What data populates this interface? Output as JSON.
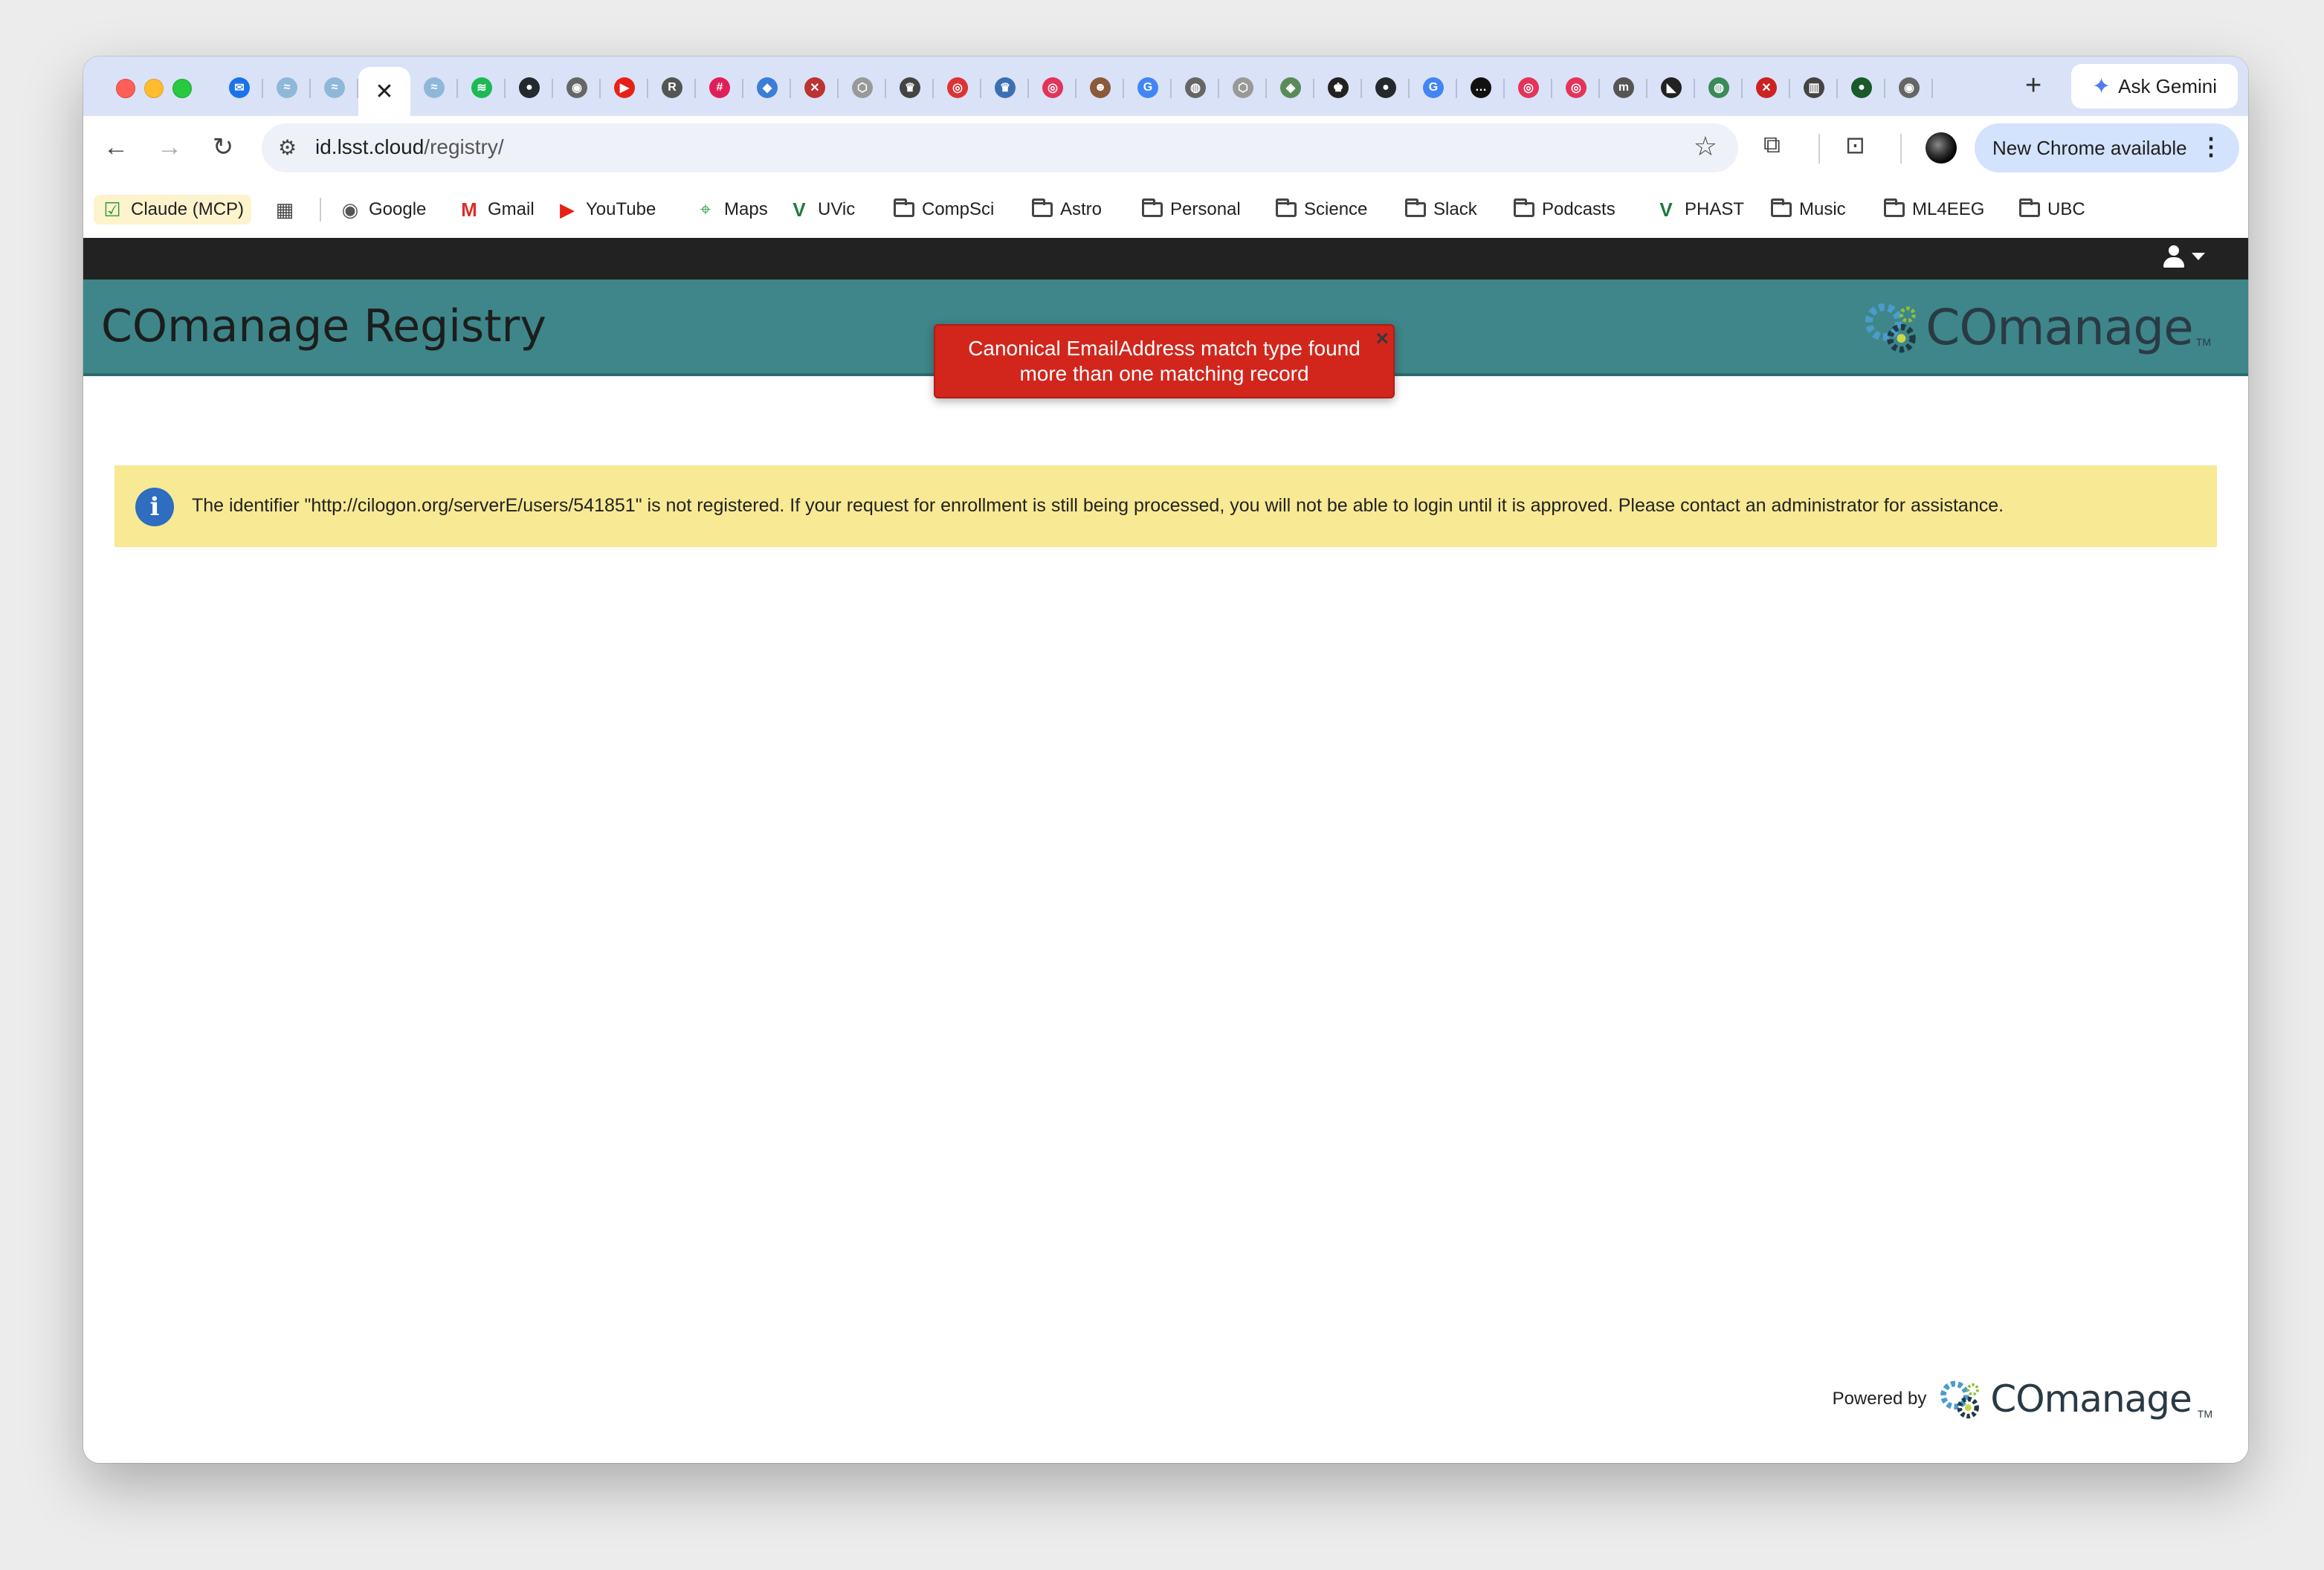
{
  "browser": {
    "url_host": "id.lsst.cloud",
    "url_path": "/registry/",
    "ask_gemini_label": "Ask Gemini",
    "update_label": "New Chrome available",
    "new_tab_symbol": "+",
    "tab_favicons": [
      {
        "icon": "outlook-icon",
        "color": "#1a73e8",
        "glyph": "✉"
      },
      {
        "icon": "cloud-icon",
        "color": "#8fb8d8",
        "glyph": "≈"
      },
      {
        "icon": "cloud-icon",
        "color": "#8fb8d8",
        "glyph": "≈"
      },
      {
        "icon": "close-icon",
        "active": true
      },
      {
        "icon": "cloud-icon",
        "color": "#8fb8d8",
        "glyph": "≈"
      },
      {
        "icon": "spotify-icon",
        "color": "#1db954",
        "glyph": "≋"
      },
      {
        "icon": "github-icon",
        "color": "#24292e",
        "glyph": "●"
      },
      {
        "icon": "chrome-icon",
        "color": "#666",
        "glyph": "◉"
      },
      {
        "icon": "youtube-icon",
        "color": "#e62117",
        "glyph": "▶"
      },
      {
        "icon": "r-icon",
        "color": "#555",
        "glyph": "R"
      },
      {
        "icon": "slack-icon",
        "color": "#e01e5a",
        "glyph": "#"
      },
      {
        "icon": "cube-icon",
        "color": "#3b7dd8",
        "glyph": "◆"
      },
      {
        "icon": "x-circle-icon",
        "color": "#b33",
        "glyph": "✕"
      },
      {
        "icon": "hex-icon",
        "color": "#999",
        "glyph": "⬡"
      },
      {
        "icon": "crown-icon",
        "color": "#444",
        "glyph": "♛"
      },
      {
        "icon": "target-icon",
        "color": "#d33",
        "glyph": "◎"
      },
      {
        "icon": "crown-icon",
        "color": "#3a6fb5",
        "glyph": "♛"
      },
      {
        "icon": "target-icon",
        "color": "#e3345a",
        "glyph": "◎"
      },
      {
        "icon": "face-icon",
        "color": "#8a5a3a",
        "glyph": "☻"
      },
      {
        "icon": "google-icon",
        "color": "#4285f4",
        "glyph": "G"
      },
      {
        "icon": "globe-icon",
        "color": "#666",
        "glyph": "◍"
      },
      {
        "icon": "hex-icon",
        "color": "#999",
        "glyph": "⬡"
      },
      {
        "icon": "badge-icon",
        "color": "#5a8a5a",
        "glyph": "◈"
      },
      {
        "icon": "crown-icon",
        "color": "#222",
        "glyph": "♚"
      },
      {
        "icon": "github-icon",
        "color": "#24292e",
        "glyph": "●"
      },
      {
        "icon": "google-icon",
        "color": "#4285f4",
        "glyph": "G"
      },
      {
        "icon": "dots-icon",
        "color": "#111",
        "glyph": "…"
      },
      {
        "icon": "target-icon",
        "color": "#e3345a",
        "glyph": "◎"
      },
      {
        "icon": "target-icon",
        "color": "#e3345a",
        "glyph": "◎"
      },
      {
        "icon": "mr-icon",
        "color": "#555",
        "glyph": "m"
      },
      {
        "icon": "bird-icon",
        "color": "#222",
        "glyph": "◣"
      },
      {
        "icon": "globe-icon",
        "color": "#3a8a5a",
        "glyph": "◍"
      },
      {
        "icon": "x-icon",
        "color": "#c22",
        "glyph": "✕"
      },
      {
        "icon": "book-icon",
        "color": "#444",
        "glyph": "▥"
      },
      {
        "icon": "dot-icon",
        "color": "#1a5a2a",
        "glyph": "●"
      },
      {
        "icon": "chrome-icon",
        "color": "#666",
        "glyph": "◉"
      }
    ],
    "bookmarks": [
      {
        "label": "Claude (MCP)",
        "icon": "check-icon"
      },
      {
        "label": "",
        "icon": "apps-grid-icon"
      },
      {
        "label": "Google",
        "icon": "chrome-icon"
      },
      {
        "label": "Gmail",
        "icon": "gmail-icon"
      },
      {
        "label": "YouTube",
        "icon": "youtube-icon"
      },
      {
        "label": "Maps",
        "icon": "maps-pin-icon"
      },
      {
        "label": "UVic",
        "icon": "v-icon"
      },
      {
        "label": "CompSci",
        "icon": "folder-icon"
      },
      {
        "label": "Astro",
        "icon": "folder-icon"
      },
      {
        "label": "Personal",
        "icon": "folder-icon"
      },
      {
        "label": "Science",
        "icon": "folder-icon"
      },
      {
        "label": "Slack",
        "icon": "folder-icon"
      },
      {
        "label": "Podcasts",
        "icon": "folder-icon"
      },
      {
        "label": "PHAST",
        "icon": "v-icon"
      },
      {
        "label": "Music",
        "icon": "folder-icon"
      },
      {
        "label": "ML4EEG",
        "icon": "folder-icon"
      },
      {
        "label": "UBC",
        "icon": "folder-icon"
      }
    ]
  },
  "app": {
    "title": "COmanage Registry",
    "brand": "COmanage",
    "tm": "TM",
    "flash_message": "Canonical EmailAddress match type found more than one matching record",
    "flash_close": "×",
    "info_icon_glyph": "i",
    "info_message": "The identifier \"http://cilogon.org/serverE/users/541851\" is not registered. If your request for enrollment is still being processed, you will not be able to login until it is approved. Please contact an administrator for assistance.",
    "footer_label": "Powered by",
    "colors": {
      "header": "#3e8689",
      "topbar": "#222222",
      "flash": "#d2261c",
      "info_bg": "#f8e994",
      "info_icon": "#2e6dbf"
    }
  }
}
